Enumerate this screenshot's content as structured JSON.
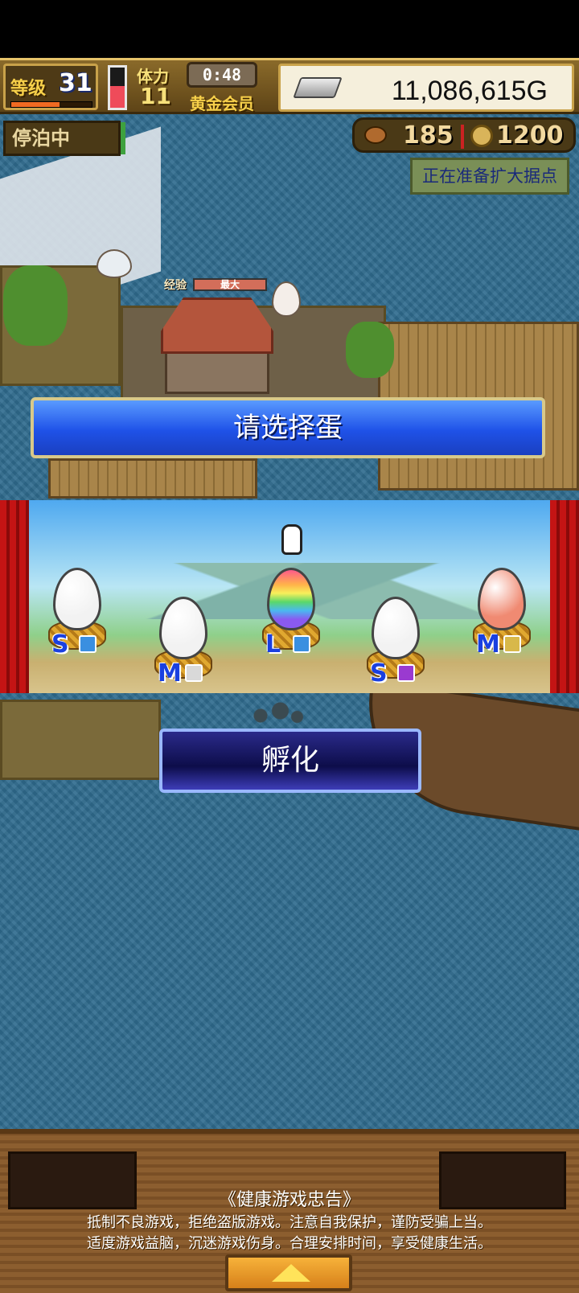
{
  "hud": {
    "level_label": "等级",
    "level": "31",
    "level_progress": 0.6,
    "stamina_label": "体力",
    "stamina": "11",
    "stamina_fill": 0.55,
    "timer": "0:48",
    "membership": "黄金会员",
    "gold": "11,086,615G"
  },
  "status": {
    "docked": "停泊中",
    "food": "185",
    "coins": "1200",
    "expand_notice": "正在准备扩大据点"
  },
  "map": {
    "exp_label": "经验",
    "exp_bar_text": "最大"
  },
  "egg_select": {
    "prompt": "请选择蛋",
    "eggs": [
      {
        "size": "S",
        "color": "#f2f2f2",
        "badge_color": "#3a8fe0"
      },
      {
        "size": "M",
        "color": "#f2f2f2",
        "badge_color": "#d9d9d9"
      },
      {
        "size": "L",
        "color": "rainbow",
        "badge_color": "#3a8fe0"
      },
      {
        "size": "S",
        "color": "#f2f2f2",
        "badge_color": "#9a3ad0"
      },
      {
        "size": "M",
        "color": "#f08a72",
        "badge_color": "#d8b84a"
      }
    ],
    "hatch_button": "孵化"
  },
  "footer": {
    "advice_title": "《健康游戏忠告》",
    "advice_line1": "抵制不良游戏，拒绝盗版游戏。注意自我保护，谨防受骗上当。",
    "advice_line2": "适度游戏益脑，沉迷游戏伤身。合理安排时间，享受健康生活。"
  }
}
